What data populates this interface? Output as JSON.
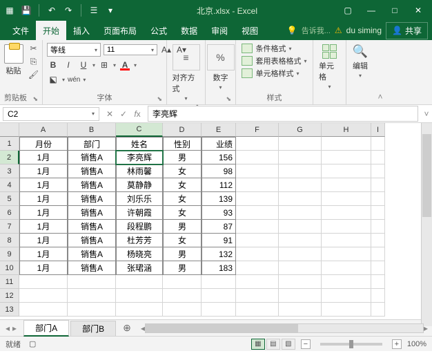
{
  "title": "北京.xlsx - Excel",
  "menubar": {
    "file": "文件",
    "home": "开始",
    "insert": "插入",
    "layout": "页面布局",
    "formula": "公式",
    "data": "数据",
    "review": "审阅",
    "view": "视图",
    "tellme": "告诉我...",
    "user": "du siming",
    "share": "共享"
  },
  "ribbon": {
    "clipboard": {
      "label": "剪贴板",
      "paste": "粘贴"
    },
    "font": {
      "label": "字体",
      "name": "等线",
      "size": "11",
      "wen": "wén"
    },
    "align": {
      "label": "对齐方式"
    },
    "number": {
      "label": "数字",
      "sym": "%"
    },
    "styles": {
      "label": "样式",
      "cond": "条件格式",
      "table": "套用表格格式",
      "cell": "单元格样式"
    },
    "cells": {
      "label": "单元格"
    },
    "edit": {
      "label": "编辑"
    }
  },
  "namebox": "C2",
  "formula": "李亮辉",
  "cols": [
    "A",
    "B",
    "C",
    "D",
    "E",
    "F",
    "G",
    "H",
    "I"
  ],
  "rows": [
    "1",
    "2",
    "3",
    "4",
    "5",
    "6",
    "7",
    "8",
    "9",
    "10",
    "11",
    "12",
    "13"
  ],
  "chart_data": {
    "type": "table",
    "headers": {
      "A": "月份",
      "B": "部门",
      "C": "姓名",
      "D": "性别",
      "E": "业绩"
    },
    "data": [
      {
        "A": "1月",
        "B": "销售A",
        "C": "李亮辉",
        "D": "男",
        "E": 156
      },
      {
        "A": "1月",
        "B": "销售A",
        "C": "林雨馨",
        "D": "女",
        "E": 98
      },
      {
        "A": "1月",
        "B": "销售A",
        "C": "莫静静",
        "D": "女",
        "E": 112
      },
      {
        "A": "1月",
        "B": "销售A",
        "C": "刘乐乐",
        "D": "女",
        "E": 139
      },
      {
        "A": "1月",
        "B": "销售A",
        "C": "许朝霞",
        "D": "女",
        "E": 93
      },
      {
        "A": "1月",
        "B": "销售A",
        "C": "段程鹏",
        "D": "男",
        "E": 87
      },
      {
        "A": "1月",
        "B": "销售A",
        "C": "杜芳芳",
        "D": "女",
        "E": 91
      },
      {
        "A": "1月",
        "B": "销售A",
        "C": "杨晓亮",
        "D": "男",
        "E": 132
      },
      {
        "A": "1月",
        "B": "销售A",
        "C": "张珺涵",
        "D": "男",
        "E": 183
      }
    ]
  },
  "tabs": {
    "a": "部门A",
    "b": "部门B"
  },
  "status": {
    "ready": "就绪",
    "zoom": "100%"
  }
}
